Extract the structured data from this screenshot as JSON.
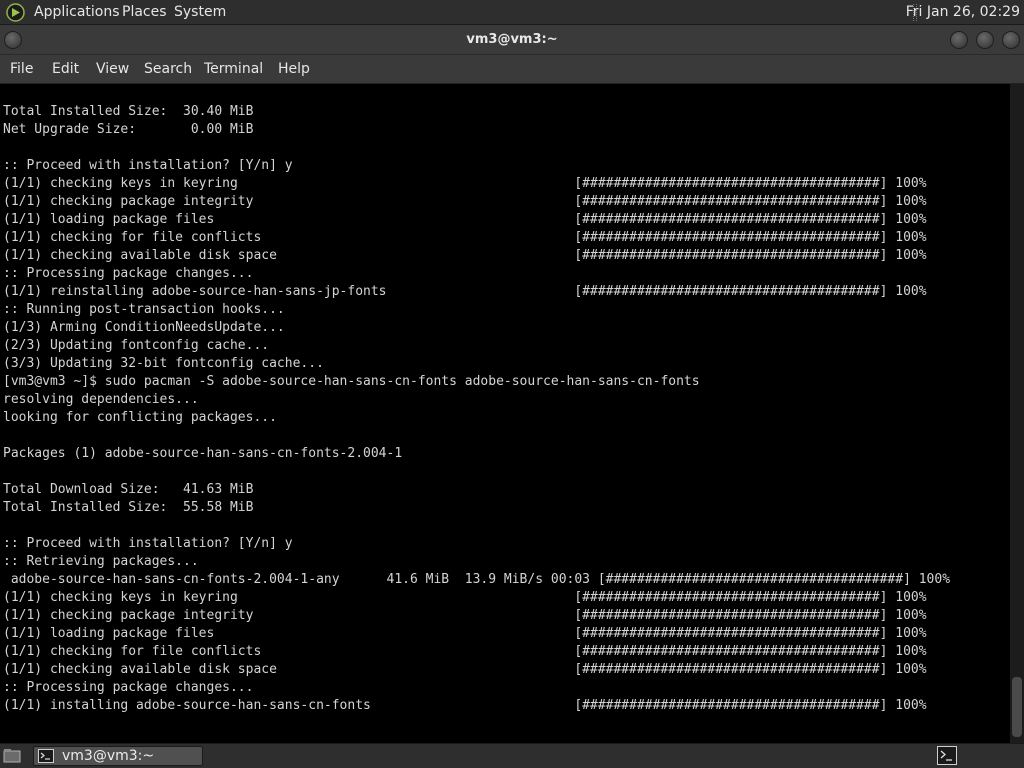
{
  "top_panel": {
    "applications": "Applications",
    "places": "Places",
    "system": "System",
    "clock": "Fri Jan 26, 02:29"
  },
  "window": {
    "title": "vm3@vm3:~"
  },
  "menu": {
    "file": "File",
    "edit": "Edit",
    "view": "View",
    "search": "Search",
    "terminal": "Terminal",
    "help": "Help"
  },
  "terminal": {
    "lines": [
      "Total Installed Size:  30.40 MiB",
      "Net Upgrade Size:       0.00 MiB",
      "",
      ":: Proceed with installation? [Y/n] y",
      "(1/1) checking keys in keyring                                           [######################################] 100%",
      "(1/1) checking package integrity                                         [######################################] 100%",
      "(1/1) loading package files                                              [######################################] 100%",
      "(1/1) checking for file conflicts                                        [######################################] 100%",
      "(1/1) checking available disk space                                      [######################################] 100%",
      ":: Processing package changes...",
      "(1/1) reinstalling adobe-source-han-sans-jp-fonts                        [######################################] 100%",
      ":: Running post-transaction hooks...",
      "(1/3) Arming ConditionNeedsUpdate...",
      "(2/3) Updating fontconfig cache...",
      "(3/3) Updating 32-bit fontconfig cache...",
      "[vm3@vm3 ~]$ sudo pacman -S adobe-source-han-sans-cn-fonts adobe-source-han-sans-cn-fonts",
      "resolving dependencies...",
      "looking for conflicting packages...",
      "",
      "Packages (1) adobe-source-han-sans-cn-fonts-2.004-1",
      "",
      "Total Download Size:   41.63 MiB",
      "Total Installed Size:  55.58 MiB",
      "",
      ":: Proceed with installation? [Y/n] y",
      ":: Retrieving packages...",
      " adobe-source-han-sans-cn-fonts-2.004-1-any      41.6 MiB  13.9 MiB/s 00:03 [######################################] 100%",
      "(1/1) checking keys in keyring                                           [######################################] 100%",
      "(1/1) checking package integrity                                         [######################################] 100%",
      "(1/1) loading package files                                              [######################################] 100%",
      "(1/1) checking for file conflicts                                        [######################################] 100%",
      "(1/1) checking available disk space                                      [######################################] 100%",
      ":: Processing package changes...",
      "(1/1) installing adobe-source-han-sans-cn-fonts                          [######################################] 100%"
    ]
  },
  "taskbar": {
    "task_label": "vm3@vm3:~"
  }
}
